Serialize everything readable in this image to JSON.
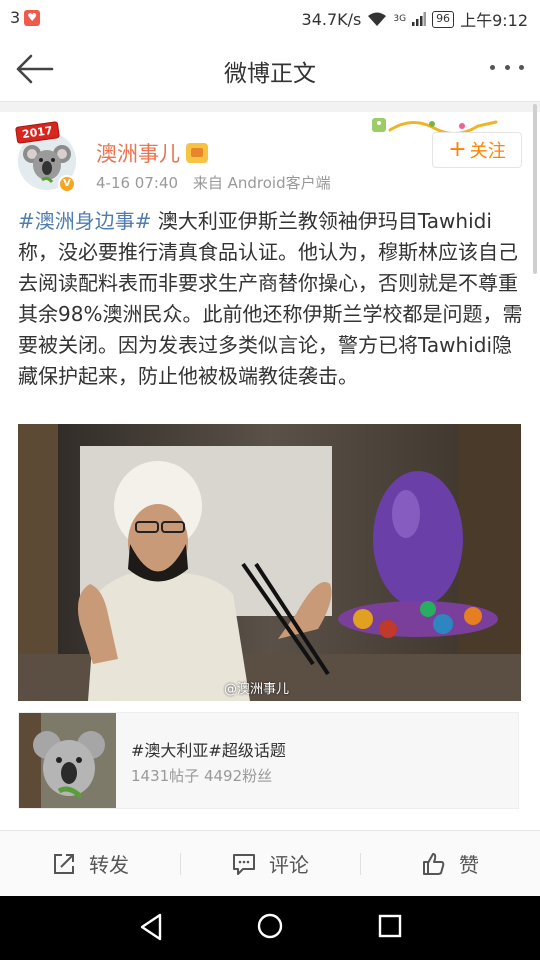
{
  "status_bar": {
    "notification_count": "3",
    "network_speed": "34.7K/s",
    "signal_label": "3G",
    "battery": "96",
    "time": "上午9:12"
  },
  "nav": {
    "title": "微博正文"
  },
  "post": {
    "avatar_badge": "2017",
    "username": "澳洲事儿",
    "date": "4-16 07:40",
    "source": "来自 Android客户端",
    "follow_label": "关注",
    "hashtag": "#澳洲身边事#",
    "text": " 澳大利亚伊斯兰教领袖伊玛目Tawhidi称，没必要推行清真食品认证。他认为，穆斯林应该自己去阅读配料表而非要求生产商替你操心，否则就是不尊重其余98%澳洲民众。此前他还称伊斯兰学校都是问题，需要被关闭。因为发表过多类似言论，警方已将Tawhidi隐藏保护起来，防止他被极端教徒袭击。",
    "image_watermark": "@澳洲事儿"
  },
  "topic_card": {
    "title": "#澳大利亚#超级话题",
    "stats": "1431帖子 4492粉丝"
  },
  "actions": {
    "repost": "转发",
    "comment": "评论",
    "like": "赞"
  },
  "colors": {
    "username": "#eb7350",
    "hashtag": "#507daf",
    "follow": "#ff8200"
  }
}
